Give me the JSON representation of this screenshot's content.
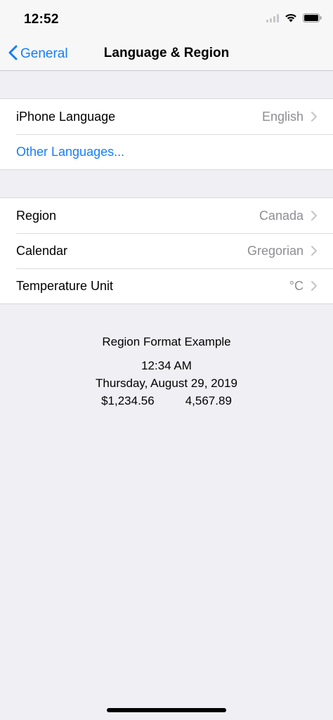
{
  "status_bar": {
    "time": "12:52"
  },
  "nav": {
    "back_label": "General",
    "title": "Language & Region"
  },
  "language_group": {
    "items": [
      {
        "label": "iPhone Language",
        "value": "English"
      },
      {
        "label": "Other Languages..."
      }
    ]
  },
  "region_group": {
    "items": [
      {
        "label": "Region",
        "value": "Canada"
      },
      {
        "label": "Calendar",
        "value": "Gregorian"
      },
      {
        "label": "Temperature Unit",
        "value": "°C"
      }
    ]
  },
  "format_example": {
    "title": "Region Format Example",
    "time": "12:34 AM",
    "date": "Thursday, August 29, 2019",
    "currency": "$1,234.56",
    "number": "4,567.89"
  },
  "colors": {
    "accent": "#147efb",
    "background": "#efeff4",
    "secondary_text": "#8e8e93"
  }
}
